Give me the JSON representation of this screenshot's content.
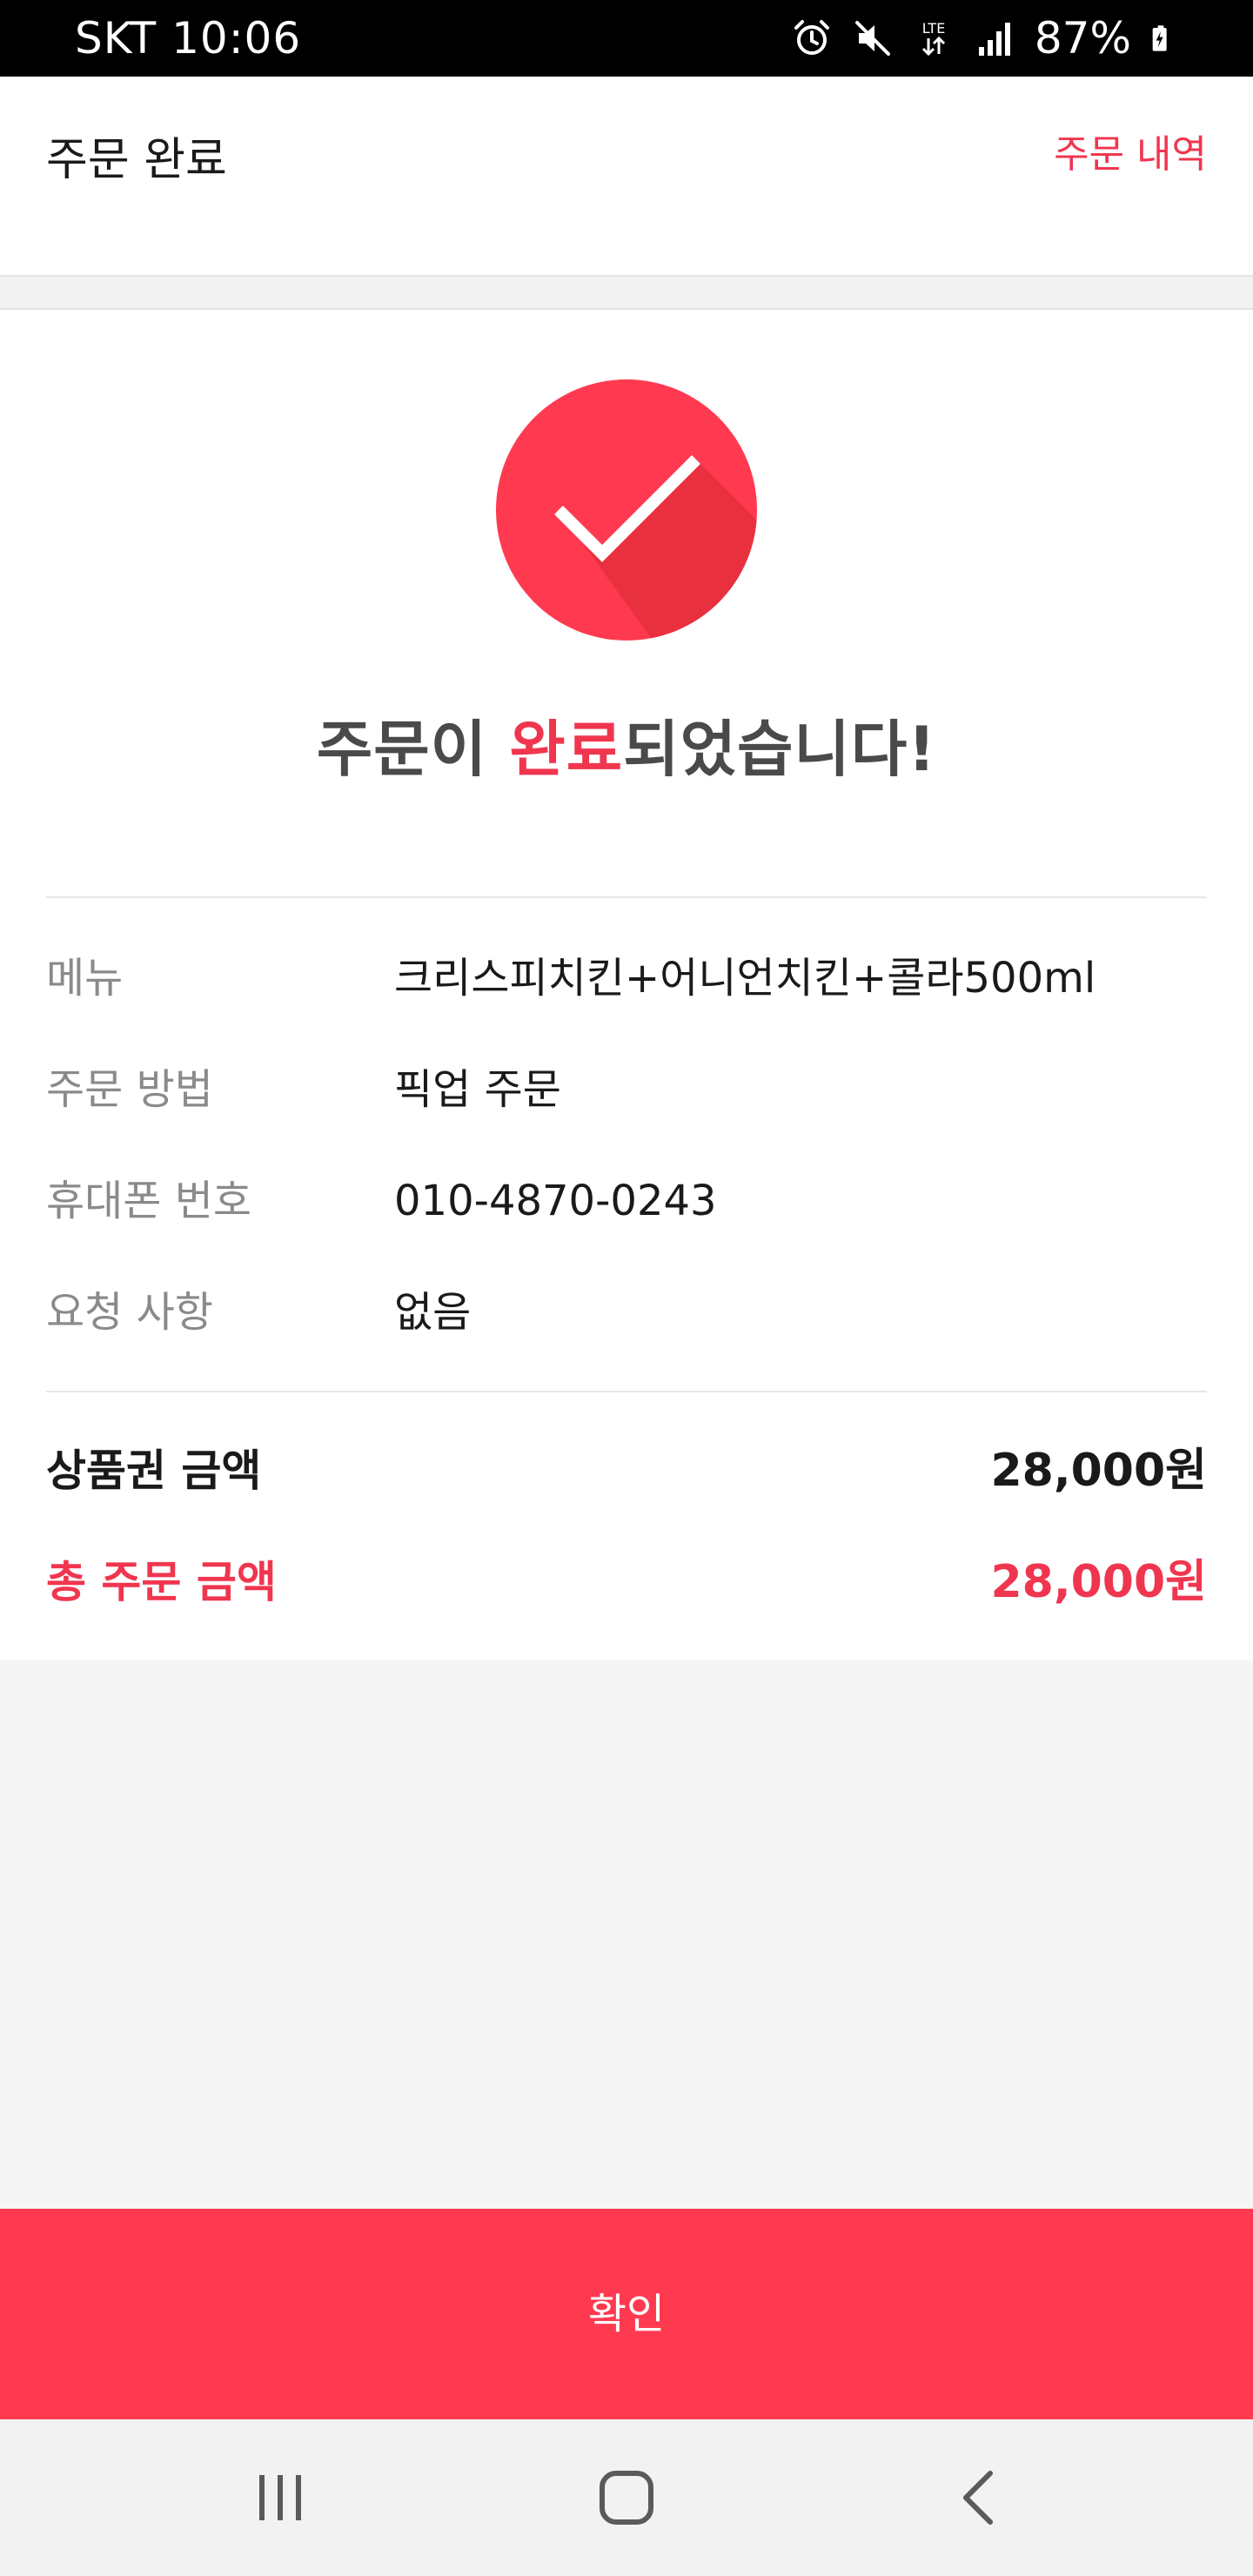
{
  "status_bar": {
    "carrier_time": "SKT 10:06",
    "network": "LTE",
    "battery": "87%"
  },
  "header": {
    "title": "주문 완료",
    "history_link": "주문 내역"
  },
  "success": {
    "headline_prefix": "주문이 ",
    "headline_accent": "완료",
    "headline_suffix": "되었습니다!",
    "icon": "check-circle-icon"
  },
  "order_details": [
    {
      "label": "메뉴",
      "value": "크리스피치킨+어니언치킨+콜라500ml"
    },
    {
      "label": "주문 방법",
      "value": "픽업 주문"
    },
    {
      "label": "휴대폰 번호",
      "value": "010-4870-0243"
    },
    {
      "label": "요청 사항",
      "value": "없음"
    }
  ],
  "amounts": {
    "voucher_label": "상품권 금액",
    "voucher_value": "28,000원",
    "total_label": "총 주문 금액",
    "total_value": "28,000원"
  },
  "confirm_button": "확인",
  "nav_bar": {
    "recents": "recents-icon",
    "home": "home-icon",
    "back": "back-icon"
  },
  "colors": {
    "accent": "#f0364f",
    "button": "#ff3a50",
    "text": "#1a1a1a",
    "muted": "#8a8a8a"
  }
}
